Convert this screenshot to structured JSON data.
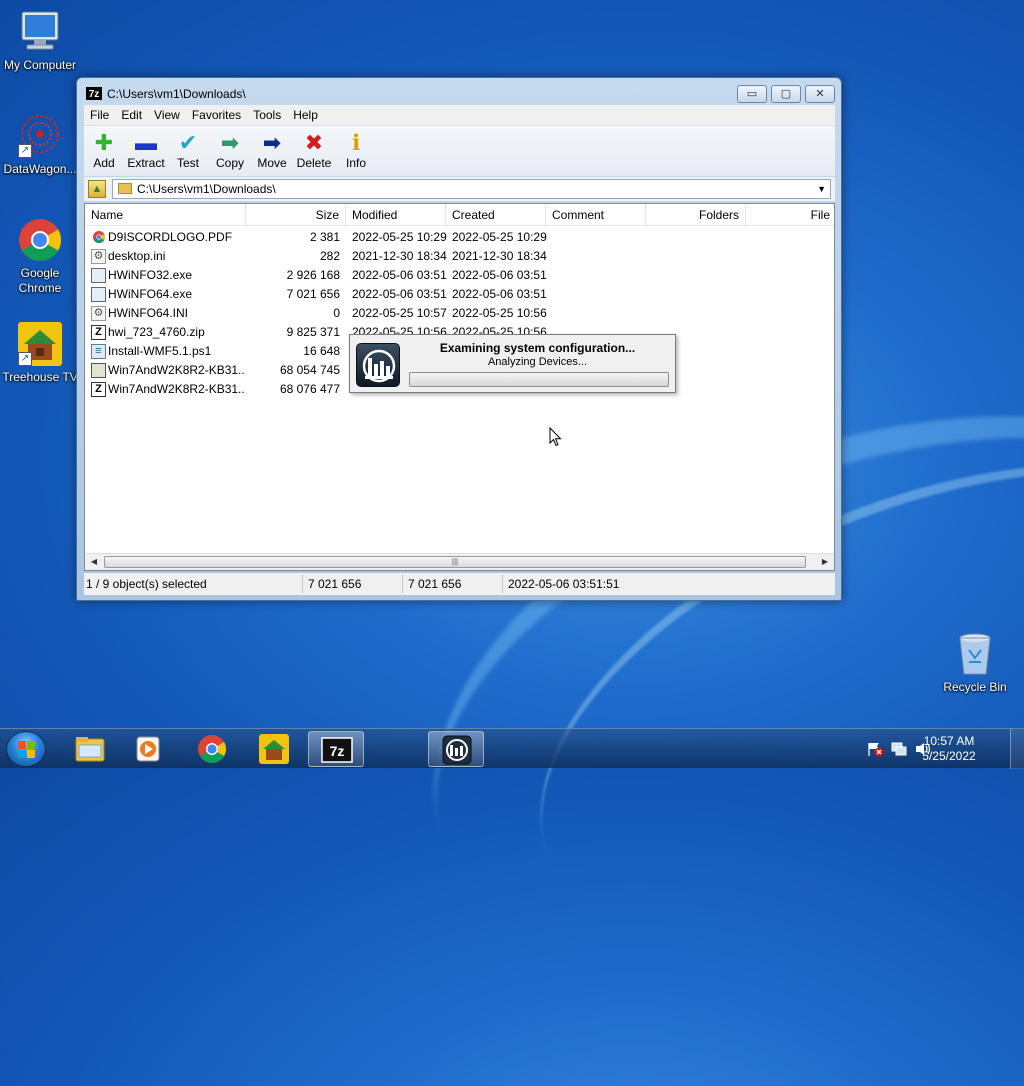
{
  "desktop": {
    "icons": [
      {
        "label": "My Computer",
        "icon": "computer-icon"
      },
      {
        "label": "DataWagon...",
        "icon": "datawagon-icon"
      },
      {
        "label": "Google Chrome",
        "icon": "chrome-icon"
      },
      {
        "label": "Treehouse TV",
        "icon": "treehouse-icon"
      },
      {
        "label": "Recycle Bin",
        "icon": "recycle-bin-icon"
      }
    ]
  },
  "window": {
    "title": "C:\\Users\\vm1\\Downloads\\",
    "app_icon_text": "7z",
    "caption": {
      "minimize": "▭",
      "maximize": "▢",
      "close": "✕"
    },
    "menu": [
      "File",
      "Edit",
      "View",
      "Favorites",
      "Tools",
      "Help"
    ],
    "toolbar": [
      {
        "label": "Add",
        "glyph": "✚",
        "color": "#2fb52f"
      },
      {
        "label": "Extract",
        "glyph": "▬",
        "color": "#1d35c9"
      },
      {
        "label": "Test",
        "glyph": "✔",
        "color": "#1fa9c6"
      },
      {
        "label": "Copy",
        "glyph": "➡",
        "color": "#2e9a6a"
      },
      {
        "label": "Move",
        "glyph": "➡",
        "color": "#102a88"
      },
      {
        "label": "Delete",
        "glyph": "✖",
        "color": "#d41c1c"
      },
      {
        "label": "Info",
        "glyph": "ℹ",
        "color": "#d6a400"
      }
    ],
    "address": "C:\\Users\\vm1\\Downloads\\",
    "columns": [
      "Name",
      "Size",
      "Modified",
      "Created",
      "Comment",
      "Folders",
      "File"
    ],
    "files": [
      {
        "name": "D9ISCORDLOGO.PDF",
        "size": "2 381",
        "modified": "2022-05-25 10:29",
        "created": "2022-05-25 10:29",
        "icon": "chrome-icon"
      },
      {
        "name": "desktop.ini",
        "size": "282",
        "modified": "2021-12-30 18:34",
        "created": "2021-12-30 18:34",
        "icon": "settings-file-icon"
      },
      {
        "name": "HWiNFO32.exe",
        "size": "2 926 168",
        "modified": "2022-05-06 03:51",
        "created": "2022-05-06 03:51",
        "icon": "exe-icon"
      },
      {
        "name": "HWiNFO64.exe",
        "size": "7 021 656",
        "modified": "2022-05-06 03:51",
        "created": "2022-05-06 03:51",
        "icon": "exe-icon"
      },
      {
        "name": "HWiNFO64.INI",
        "size": "0",
        "modified": "2022-05-25 10:57",
        "created": "2022-05-25 10:56",
        "icon": "settings-file-icon"
      },
      {
        "name": "hwi_723_4760.zip",
        "size": "9 825 371",
        "modified": "2022-05-25 10:56",
        "created": "2022-05-25 10:56",
        "icon": "zip-icon"
      },
      {
        "name": "Install-WMF5.1.ps1",
        "size": "16 648",
        "modified": "",
        "created": "",
        "icon": "script-icon"
      },
      {
        "name": "Win7AndW2K8R2-KB31...",
        "size": "68 054 745",
        "modified": "",
        "created": "",
        "icon": "archive-icon"
      },
      {
        "name": "Win7AndW2K8R2-KB31...",
        "size": "68 076 477",
        "modified": "",
        "created": "",
        "icon": "zip-icon"
      }
    ],
    "status": {
      "selected": "1 / 9 object(s) selected",
      "size1": "7 021 656",
      "size2": "7 021 656",
      "date": "2022-05-06 03:51:51"
    }
  },
  "popup": {
    "title": "Examining system configuration...",
    "subtitle": "Analyzing Devices...",
    "progress": 0
  },
  "taskbar": {
    "apps": [
      "explorer-icon",
      "media-player-icon",
      "chrome-icon",
      "treehouse-icon",
      "7zip-icon",
      "hwinfo-icon"
    ],
    "tray": [
      "action-center-icon",
      "network-icon",
      "volume-icon"
    ],
    "time": "10:57 AM",
    "date": "5/25/2022"
  }
}
